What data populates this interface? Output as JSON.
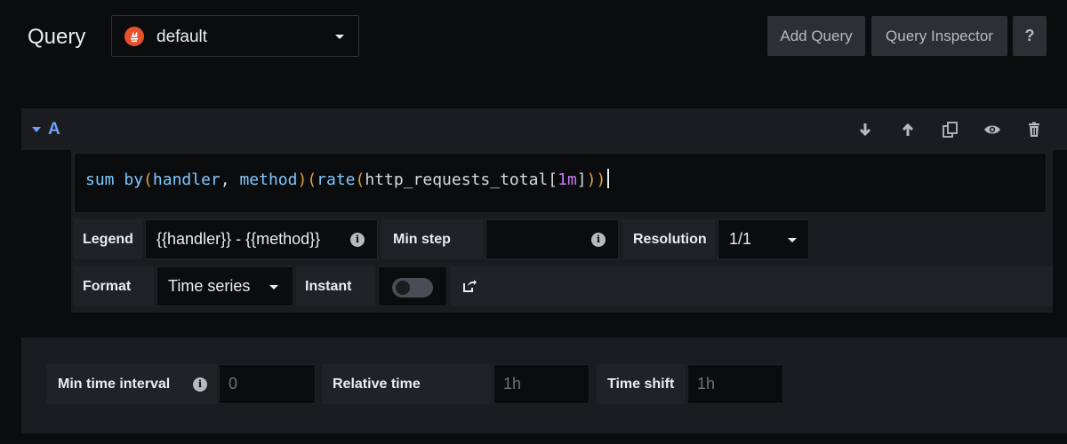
{
  "header": {
    "title": "Query",
    "datasource": "default",
    "buttons": {
      "add_query": "Add Query",
      "query_inspector": "Query Inspector",
      "help": "?"
    }
  },
  "query": {
    "ref_id": "A",
    "expression_tokens": [
      {
        "text": "sum",
        "cls": "t-kw"
      },
      {
        "text": " ",
        "cls": "t-punct"
      },
      {
        "text": "by",
        "cls": "t-kw"
      },
      {
        "text": "(",
        "cls": "t-paren"
      },
      {
        "text": "handler",
        "cls": "t-id"
      },
      {
        "text": ", ",
        "cls": "t-punct"
      },
      {
        "text": "method",
        "cls": "t-id"
      },
      {
        "text": ")",
        "cls": "t-paren"
      },
      {
        "text": "(",
        "cls": "t-paren"
      },
      {
        "text": "rate",
        "cls": "t-kw"
      },
      {
        "text": "(",
        "cls": "t-paren"
      },
      {
        "text": "http_requests_total",
        "cls": "t-metric"
      },
      {
        "text": "[",
        "cls": "t-punct"
      },
      {
        "text": "1m",
        "cls": "t-num"
      },
      {
        "text": "]",
        "cls": "t-punct"
      },
      {
        "text": ")",
        "cls": "t-paren"
      },
      {
        "text": ")",
        "cls": "t-paren"
      }
    ],
    "actions": [
      "move-down-icon",
      "move-up-icon",
      "duplicate-icon",
      "eye-icon",
      "trash-icon"
    ]
  },
  "fields": {
    "legend_label": "Legend",
    "legend_value": "{{handler}} - {{method}}",
    "min_step_label": "Min step",
    "min_step_value": "",
    "resolution_label": "Resolution",
    "resolution_value": "1/1",
    "format_label": "Format",
    "format_value": "Time series",
    "instant_label": "Instant",
    "instant_on": false
  },
  "options": {
    "min_time_interval_label": "Min time interval",
    "min_time_interval_placeholder": "0",
    "relative_time_label": "Relative time",
    "relative_time_placeholder": "1h",
    "time_shift_label": "Time shift",
    "time_shift_placeholder": "1h"
  }
}
